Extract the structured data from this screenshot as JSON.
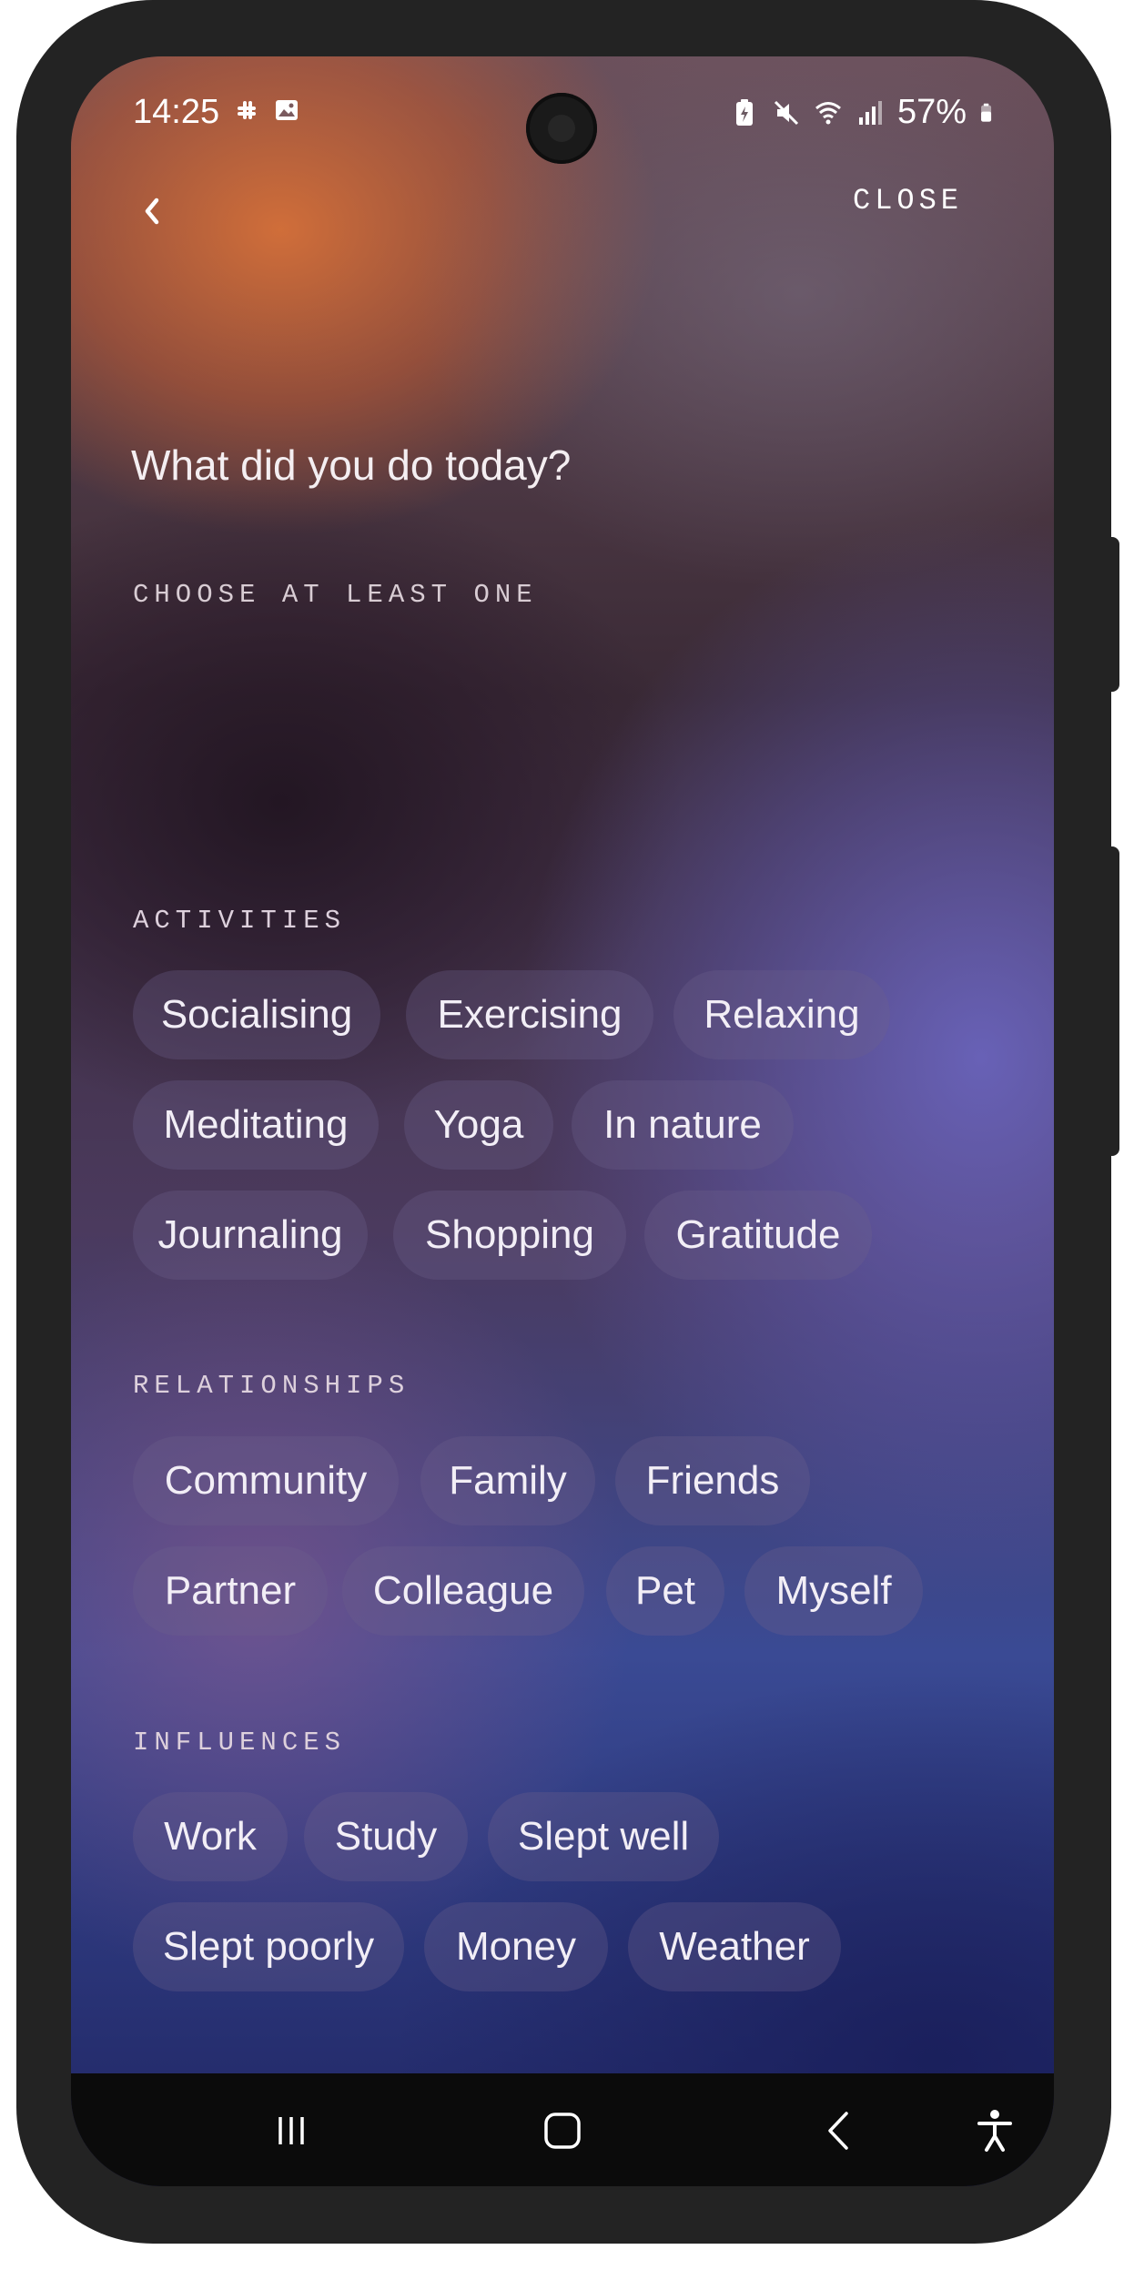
{
  "status_bar": {
    "time": "14:25",
    "battery": "57%",
    "icons_left": [
      "slack-icon",
      "image-icon"
    ],
    "icons_right": [
      "battery-saver-icon",
      "mute-icon",
      "wifi-icon",
      "signal-icon",
      "battery-icon"
    ]
  },
  "header": {
    "close_label": "CLOSE"
  },
  "question": {
    "title": "What did you do today?",
    "subtitle": "CHOOSE AT LEAST ONE"
  },
  "sections": [
    {
      "label": "ACTIVITIES",
      "chips": [
        "Socialising",
        "Exercising",
        "Relaxing",
        "Meditating",
        "Yoga",
        "In nature",
        "Journaling",
        "Shopping",
        "Gratitude"
      ]
    },
    {
      "label": "RELATIONSHIPS",
      "chips": [
        "Community",
        "Family",
        "Friends",
        "Partner",
        "Colleague",
        "Pet",
        "Myself"
      ]
    },
    {
      "label": "INFLUENCES",
      "chips": [
        "Work",
        "Study",
        "Slept well",
        "Slept poorly",
        "Money",
        "Weather"
      ]
    }
  ],
  "navigation": {
    "buttons": [
      "recent-apps-icon",
      "home-icon",
      "back-icon",
      "accessibility-icon"
    ]
  }
}
